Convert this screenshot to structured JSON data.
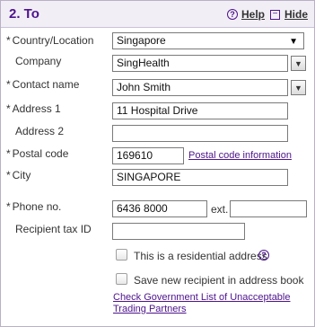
{
  "section": {
    "title": "2. To",
    "help_label": "Help",
    "hide_label": "Hide",
    "help_icon": "?",
    "hide_icon": "−"
  },
  "form": {
    "country": {
      "label": "Country/Location",
      "value": "Singapore"
    },
    "company": {
      "label": "Company",
      "value": "SingHealth"
    },
    "contact": {
      "label": "Contact name",
      "value": "John Smith"
    },
    "address1": {
      "label": "Address 1",
      "value": "11 Hospital Drive"
    },
    "address2": {
      "label": "Address 2",
      "value": ""
    },
    "postal": {
      "label": "Postal code",
      "value": "169610",
      "link": "Postal code information"
    },
    "city": {
      "label": "City",
      "value": "SINGAPORE"
    },
    "phone": {
      "label": "Phone no.",
      "value": "6436 8000",
      "ext_label": "ext.",
      "ext_value": ""
    },
    "tax": {
      "label": "Recipient tax ID",
      "value": ""
    },
    "residential": {
      "label": "This is a residential address",
      "checked": false
    },
    "save_recipient": {
      "label": "Save new recipient in address book",
      "checked": false
    },
    "gov_link": {
      "line1": "Check Government List of Unacceptable",
      "line2": "Trading Partners"
    },
    "required_mark": "*",
    "dropdown_arrow": "▼"
  },
  "colors": {
    "accent": "#4d148c",
    "header_bg": "#f2eef6"
  }
}
